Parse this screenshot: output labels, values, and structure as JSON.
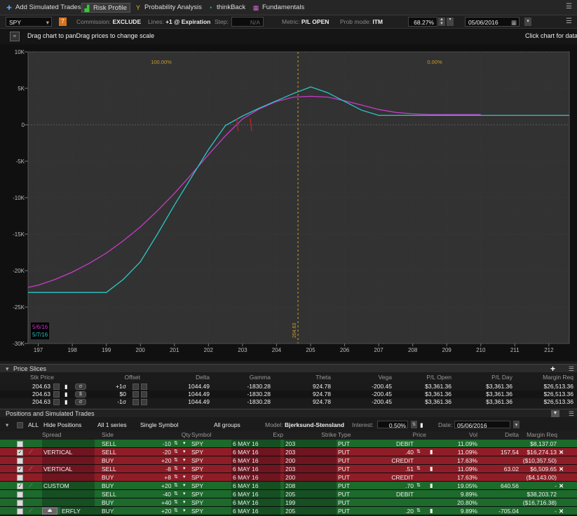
{
  "tabs": [
    {
      "label": "Add Simulated Trades",
      "icon": "add-simulated-trades-icon"
    },
    {
      "label": "Risk Profile",
      "icon": "risk-profile-icon"
    },
    {
      "label": "Probability Analysis",
      "icon": "probability-analysis-icon"
    },
    {
      "label": "thinkBack",
      "icon": "thinkback-icon"
    },
    {
      "label": "Fundamentals",
      "icon": "fundamentals-icon"
    }
  ],
  "toolbar": {
    "symbol": "SPY",
    "badge": "7",
    "commission_label": "Commission:",
    "commission_value": "EXCLUDE",
    "lines_label": "Lines:",
    "lines_value": "+1 @ Expiration",
    "step_label": "Step:",
    "step_value": "N/A",
    "metric_label": "Metric:",
    "metric_value": "P/L OPEN",
    "prob_label": "Prob mode:",
    "prob_value": "ITM",
    "prob_pct": "68.27%",
    "date": "05/06/2016"
  },
  "chart_header": {
    "hint": "Drag chart to panDrag prices to change scale",
    "right_hint": "Click chart for data"
  },
  "chart_data": {
    "type": "line",
    "x_ticks": [
      "197",
      "198",
      "199",
      "200",
      "201",
      "202",
      "203",
      "204",
      "205",
      "206",
      "207",
      "208",
      "209",
      "210",
      "211",
      "212"
    ],
    "y_ticks": [
      "10K",
      "5K",
      "0",
      "-5K",
      "-10K",
      "-15K",
      "-20K",
      "-25K",
      "-30K"
    ],
    "xlim": [
      196.7,
      212.6
    ],
    "ylim": [
      -30000,
      10000
    ],
    "current_price": 204.63,
    "current_price_label": "204.63",
    "prob_left_label": "100.00%",
    "prob_right_label": "0.00%",
    "grid": true,
    "series": [
      {
        "name": "5/6/16",
        "color": "#c63cc6",
        "x": [
          196.7,
          197,
          197.5,
          198,
          198.5,
          199,
          199.5,
          200,
          200.5,
          201,
          201.5,
          202,
          202.5,
          203,
          203.5,
          204,
          204.5,
          205,
          205.5,
          206,
          206.5,
          207,
          207.5,
          208,
          208.5,
          209,
          209.5,
          210
        ],
        "y": [
          -22300,
          -22000,
          -21200,
          -20200,
          -19000,
          -17600,
          -15900,
          -14000,
          -11800,
          -9400,
          -6800,
          -4100,
          -1500,
          800,
          2200,
          3200,
          3800,
          3900,
          3800,
          3300,
          2700,
          2100,
          1700,
          1500,
          1400,
          1400,
          1400,
          1400
        ]
      },
      {
        "name": "5/7/16",
        "color": "#2ec6c6",
        "x": [
          196.7,
          199,
          199.5,
          200,
          200.5,
          201,
          201.5,
          202,
          202.5,
          203,
          203.5,
          204,
          204.5,
          204.9,
          205,
          205.5,
          206,
          206.5,
          207,
          208,
          209,
          210,
          211,
          212,
          212.6
        ],
        "y": [
          -23000,
          -23000,
          -21200,
          -18800,
          -15000,
          -11000,
          -7200,
          -3400,
          -100,
          1200,
          2300,
          3300,
          4300,
          5000,
          5200,
          4400,
          3200,
          2000,
          1300,
          1300,
          1300,
          1300,
          1300,
          1300,
          1300
        ]
      }
    ]
  },
  "price_slices": {
    "title": "Price Slices",
    "headers": [
      "Stk Price",
      "Offset",
      "Delta",
      "Gamma",
      "Theta",
      "Vega",
      "P/L Open",
      "P/L Day",
      "Margin Req"
    ],
    "rows": [
      {
        "stk_price": "204.63",
        "mode": "σ",
        "offset": "+1σ",
        "delta": "1044.49",
        "gamma": "-1830.28",
        "theta": "924.78",
        "vega": "-200.45",
        "pl_open": "$3,361.36",
        "pl_day": "$3,361.36",
        "margin": "$26,513.36"
      },
      {
        "stk_price": "204.63",
        "mode": "$",
        "offset": "$0",
        "delta": "1044.49",
        "gamma": "-1830.28",
        "theta": "924.78",
        "vega": "-200.45",
        "pl_open": "$3,361.36",
        "pl_day": "$3,361.36",
        "margin": "$26,513.36"
      },
      {
        "stk_price": "204.63",
        "mode": "σ",
        "offset": "-1σ",
        "delta": "1044.49",
        "gamma": "-1830.28",
        "theta": "924.78",
        "vega": "-200.45",
        "pl_open": "$3,361.36",
        "pl_day": "$3,361.36",
        "margin": "$26,513.36"
      }
    ]
  },
  "positions": {
    "title": "Positions and Simulated Trades",
    "all_label": "ALL",
    "hide_positions": "Hide Positions",
    "series_select": "All 1 series",
    "symbol_select": "Single Symbol",
    "groups_select": "All groups",
    "model_label": "Model:",
    "model_value": "Bjerksund-Stensland",
    "interest_label": "Interest:",
    "interest_value": "0.50%",
    "date_label": "Date:",
    "date_value": "05/06/2016",
    "headers": [
      "Spread",
      "Side",
      "Qty",
      "Symbol",
      "Exp",
      "Strike",
      "Type",
      "Price",
      "Vol",
      "Delta",
      "Margin Req"
    ],
    "rows": [
      {
        "color": "green",
        "check": false,
        "spread": "",
        "side": "SELL",
        "qty": "-10",
        "symbol": "SPY",
        "exp": "6 MAY 16",
        "strike": "203",
        "type": "PUT",
        "price": "DEBIT",
        "vol": "11.09%",
        "delta": "",
        "margin": "$8,137.07",
        "x": false
      },
      {
        "color": "red",
        "check": true,
        "spread": "VERTICAL",
        "side": "SELL",
        "qty": "-20",
        "symbol": "SPY",
        "exp": "6 MAY 16",
        "strike": "203",
        "type": "PUT",
        "price": ".40",
        "vol": "11.09%",
        "delta": "157.54",
        "margin": "$16,274.13",
        "x": true
      },
      {
        "color": "red",
        "check": false,
        "spread": "",
        "side": "BUY",
        "qty": "+20",
        "symbol": "SPY",
        "exp": "6 MAY 16",
        "strike": "200",
        "type": "PUT",
        "price": "CREDIT",
        "vol": "17.63%",
        "delta": "",
        "margin": "($10,357.50)",
        "x": false
      },
      {
        "color": "red",
        "check": true,
        "spread": "VERTICAL",
        "side": "SELL",
        "qty": "-8",
        "symbol": "SPY",
        "exp": "6 MAY 16",
        "strike": "203",
        "type": "PUT",
        "price": ".51",
        "vol": "11.09%",
        "delta": "63.02",
        "margin": "$6,509.65",
        "x": true
      },
      {
        "color": "red",
        "check": false,
        "spread": "",
        "side": "BUY",
        "qty": "+8",
        "symbol": "SPY",
        "exp": "6 MAY 16",
        "strike": "200",
        "type": "PUT",
        "price": "CREDIT",
        "vol": "17.63%",
        "delta": "",
        "margin": "($4,143.00)",
        "x": false
      },
      {
        "color": "green",
        "check": true,
        "spread": "CUSTOM",
        "side": "BUY",
        "qty": "+20",
        "symbol": "SPY",
        "exp": "6 MAY 16",
        "strike": "208",
        "type": "PUT",
        "price": ".70",
        "vol": "19.05%",
        "delta": "640.56",
        "margin": "-",
        "x": true
      },
      {
        "color": "green",
        "check": false,
        "spread": "",
        "side": "SELL",
        "qty": "-40",
        "symbol": "SPY",
        "exp": "6 MAY 16",
        "strike": "205",
        "type": "PUT",
        "price": "DEBIT",
        "vol": "9.89%",
        "delta": "",
        "margin": "$38,203.72",
        "x": false
      },
      {
        "color": "green",
        "check": false,
        "spread": "",
        "side": "BUY",
        "qty": "+40",
        "symbol": "SPY",
        "exp": "6 MAY 16",
        "strike": "199",
        "type": "PUT",
        "price": "",
        "vol": "20.80%",
        "delta": "",
        "margin": "($16,716.38)",
        "x": false
      },
      {
        "color": "green",
        "check": false,
        "spread": "ERFLY",
        "side": "BUY",
        "qty": "+20",
        "symbol": "SPY",
        "exp": "6 MAY 16",
        "strike": "205",
        "type": "PUT",
        "price": ".20",
        "vol": "9.89%",
        "delta": "-705.04",
        "margin": "-",
        "x": true
      }
    ]
  }
}
